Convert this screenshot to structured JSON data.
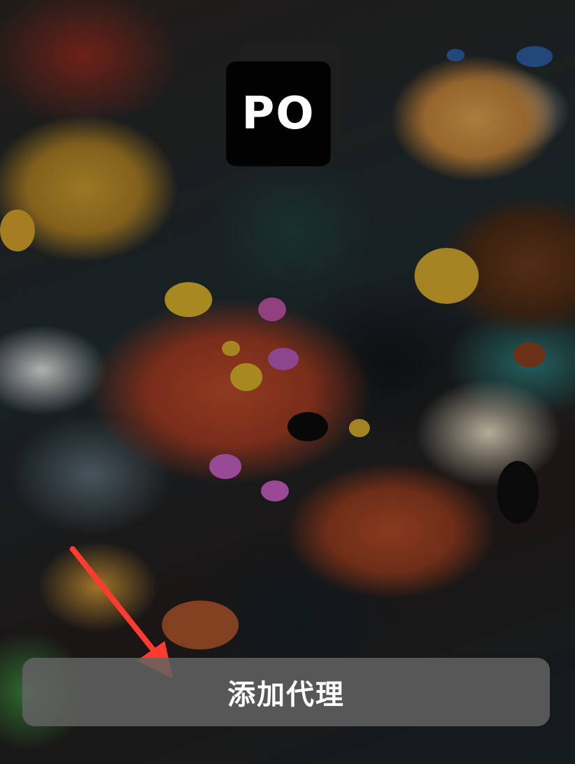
{
  "app_icon": {
    "label": "PO",
    "icon": "proxy-app-icon"
  },
  "add_proxy_button": {
    "label": "添加代理"
  },
  "annotation": {
    "icon": "red-arrow-icon",
    "color": "#ff3b30"
  },
  "colors": {
    "button_background": "#626262",
    "button_text": "#ffffff",
    "icon_background": "#020202"
  }
}
